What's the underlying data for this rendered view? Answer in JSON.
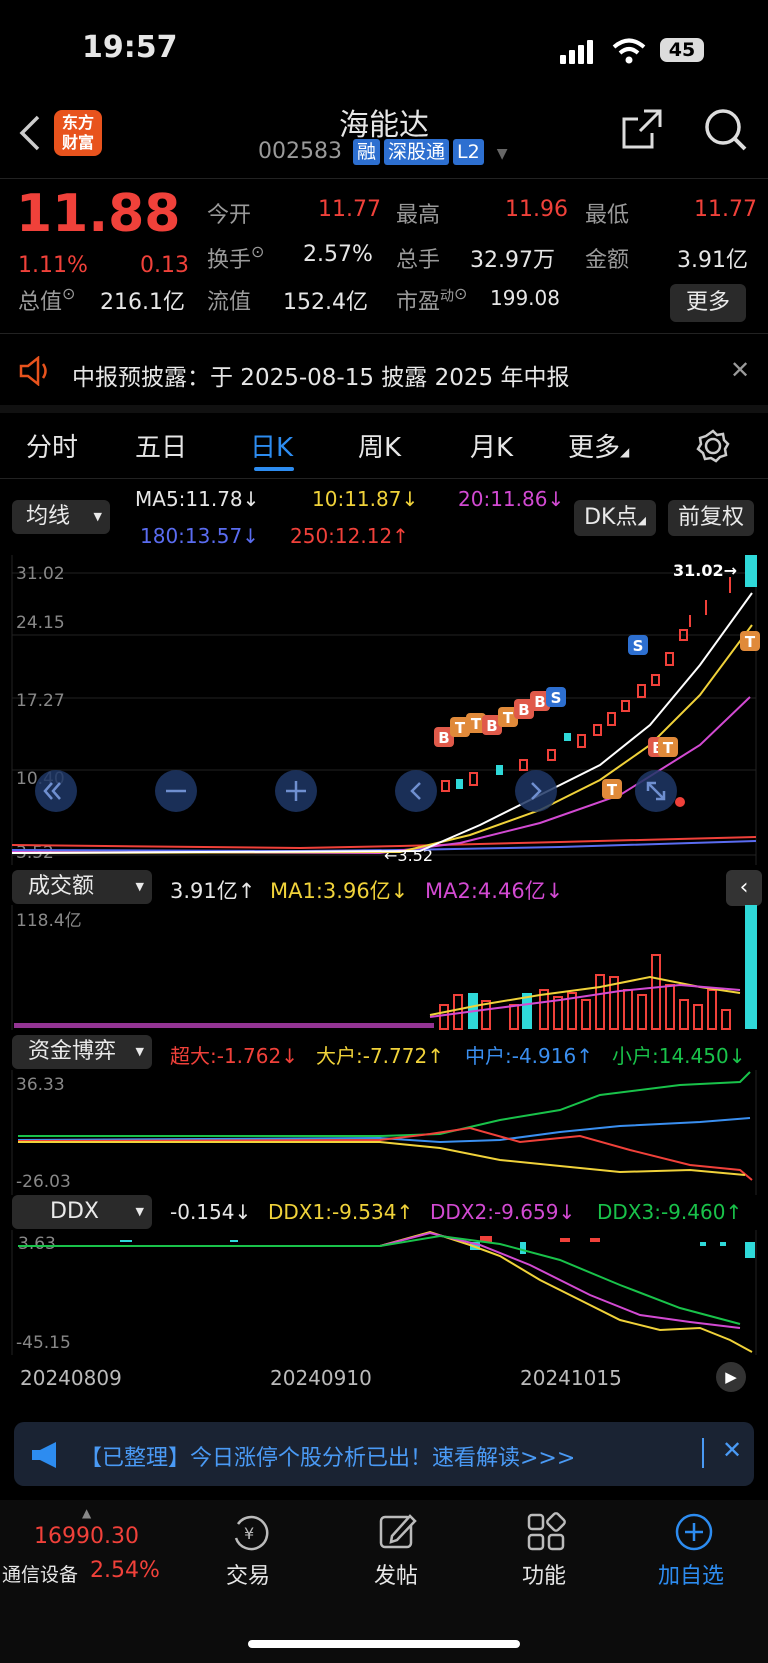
{
  "status_bar": {
    "time": "19:57",
    "battery": "45"
  },
  "header": {
    "logo_line1": "东方",
    "logo_line2": "财富",
    "title": "海能达",
    "code": "002583",
    "badges": [
      "融",
      "深股通",
      "L2"
    ]
  },
  "quote": {
    "price": "11.88",
    "change_pct": "1.11%",
    "change": "0.13",
    "fields": [
      {
        "label": "今开",
        "value": "11.77"
      },
      {
        "label": "最高",
        "value": "11.96"
      },
      {
        "label": "最低",
        "value": "11.77"
      },
      {
        "label": "换手",
        "value": "2.57%"
      },
      {
        "label": "总手",
        "value": "32.97万"
      },
      {
        "label": "金额",
        "value": "3.91亿"
      },
      {
        "label": "总值",
        "value": "216.1亿"
      },
      {
        "label": "流值",
        "value": "152.4亿"
      },
      {
        "label": "市盈",
        "sup": "动",
        "value": "199.08"
      }
    ],
    "more_button": "更多"
  },
  "notice": {
    "text": "中报预披露：于 2025-08-15 披露 2025 年中报"
  },
  "tabs": [
    "分时",
    "五日",
    "日K",
    "周K",
    "月K",
    "更多"
  ],
  "active_tab": "日K",
  "ma_panel": {
    "selector": "均线",
    "ma5": "MA5:11.78↓",
    "ma10": "10:11.87↓",
    "ma20": "20:11.86↓",
    "ma180": "180:13.57↓",
    "ma250": "250:12.12↑",
    "dk_button": "DK点",
    "adjust_button": "前复权",
    "y_ticks": [
      "31.02",
      "24.15",
      "17.27",
      "10.40",
      "3.52"
    ],
    "max_label": "31.02→",
    "min_label": "←3.52"
  },
  "volume_panel": {
    "selector": "成交额",
    "value": "3.91亿↑",
    "ma1": "MA1:3.96亿↓",
    "ma2": "MA2:4.46亿↓",
    "y_top": "118.4亿"
  },
  "fund_panel": {
    "selector": "资金博弈",
    "super": "超大:-1.762↓",
    "large": "大户:-7.772↑",
    "mid": "中户:-4.916↑",
    "small": "小户:14.450↓",
    "y_top": "36.33",
    "y_bottom": "-26.03"
  },
  "ddx_panel": {
    "selector": "DDX",
    "value": "-0.154↓",
    "ddx1": "DDX1:-9.534↑",
    "ddx2": "DDX2:-9.659↓",
    "ddx3": "DDX3:-9.460↑",
    "y_top": "3.63",
    "y_bottom": "-45.15"
  },
  "dates": [
    "20240809",
    "20240910",
    "20241015"
  ],
  "ad_banner": {
    "text": "【已整理】今日涨停个股分析已出！速看解读>>>"
  },
  "bottom_bar": {
    "index_value": "16990.30",
    "index_name": "通信设备",
    "index_change": "2.54%",
    "items": [
      "交易",
      "发帖",
      "功能",
      "加自选"
    ]
  },
  "colors": {
    "up": "#f0413a",
    "down": "#19c24a",
    "accent": "#2d8cf0",
    "logo": "#e8531d"
  }
}
